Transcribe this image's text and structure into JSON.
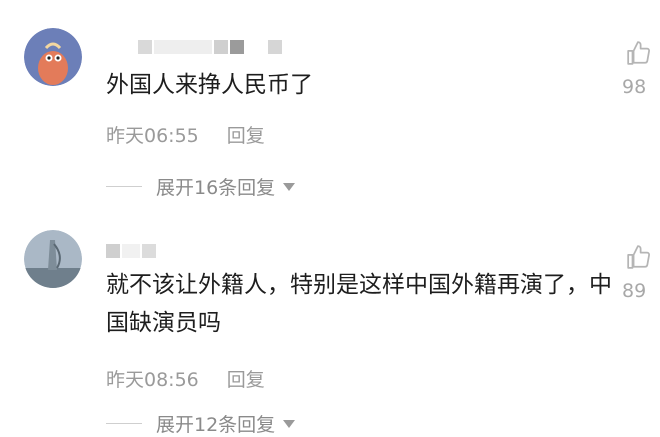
{
  "comments": [
    {
      "text": "外国人来挣人民币了",
      "time": "昨天06:55",
      "reply_label": "回复",
      "expand_label": "展开16条回复",
      "likes": "98"
    },
    {
      "text": "就不该让外籍人，特别是这样中国外籍再演了，中国缺演员吗",
      "time": "昨天08:56",
      "reply_label": "回复",
      "expand_label": "展开12条回复",
      "likes": "89"
    }
  ],
  "colors": {
    "text": "#1e1e1e",
    "meta": "#9a9a9a",
    "mosaic": "#d9d9d9",
    "avatar1_bg": "#6c7fb8",
    "avatar1_face": "#e37b5a",
    "avatar2_sky": "#aab8c6"
  },
  "icons": {
    "like": "thumb-up-icon",
    "expand": "triangle-down-icon"
  }
}
